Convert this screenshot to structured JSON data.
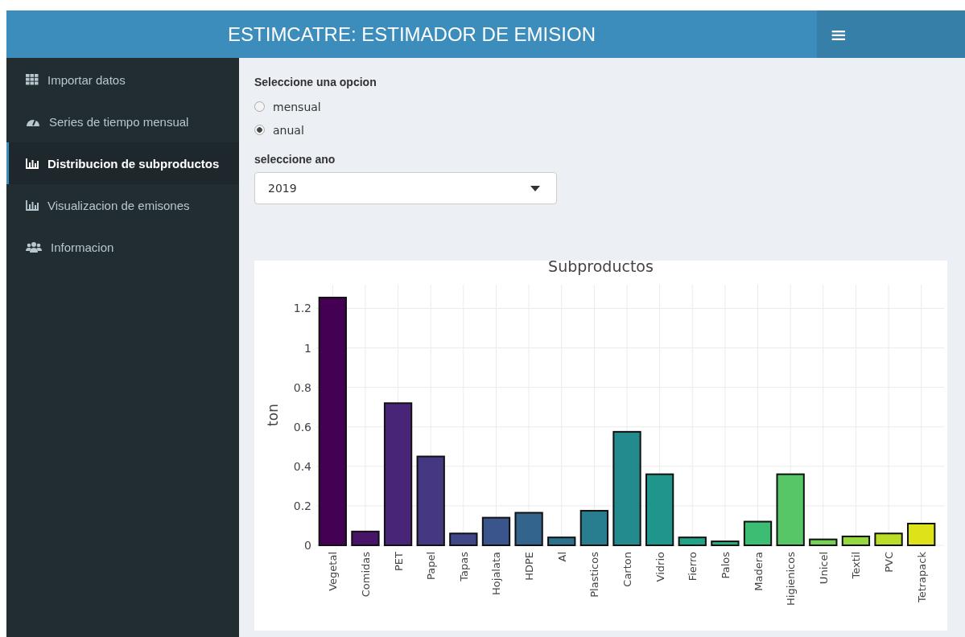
{
  "header": {
    "title": "ESTIMCATRE: ESTIMADOR DE EMISION",
    "menu_icon": "≡"
  },
  "sidebar": {
    "items": [
      {
        "label": "Importar datos",
        "selected": false
      },
      {
        "label": "Series de tiempo mensual",
        "selected": false
      },
      {
        "label": "Distribucion de subproductos",
        "selected": true
      },
      {
        "label": "Visualizacion de emisones",
        "selected": false
      },
      {
        "label": "Informacion",
        "selected": false
      }
    ]
  },
  "options": {
    "label": "Seleccione una opcion",
    "radios": [
      {
        "label": "mensual",
        "selected": false
      },
      {
        "label": "anual",
        "selected": true
      }
    ]
  },
  "year_select": {
    "label": "seleccione ano",
    "value": "2019"
  },
  "chart": {
    "chart_data": {
      "type": "bar",
      "title": "Subproductos",
      "ylabel": "ton",
      "categories": [
        "Vegetal",
        "Comidas",
        "PET",
        "Papel",
        "Tapas",
        "Hojalata",
        "HDPE",
        "Al",
        "Plasticos",
        "Carton",
        "Vidrio",
        "Fierro",
        "Palos",
        "Madera",
        "Higienicos",
        "Unicel",
        "Textil",
        "PVC",
        "Tetrapack"
      ],
      "grid": true,
      "series": [
        {
          "values": [
            1.255,
            0.07,
            0.72,
            0.45,
            0.06,
            0.14,
            0.165,
            0.04,
            0.175,
            0.575,
            0.36,
            0.04,
            0.02,
            0.12,
            0.36,
            0.03,
            0.045,
            0.06,
            0.11
          ]
        }
      ],
      "ylim": [
        0,
        1.32
      ],
      "yticks": [
        {
          "value": 0,
          "label": "0"
        },
        {
          "value": 0.2,
          "label": "0.2"
        },
        {
          "value": 0.4,
          "label": "0.4"
        },
        {
          "value": 0.6,
          "label": "0.6"
        },
        {
          "value": 0.8,
          "label": "0.8"
        },
        {
          "value": 1,
          "label": "1"
        },
        {
          "value": 1.2,
          "label": "1.2"
        }
      ]
    }
  }
}
